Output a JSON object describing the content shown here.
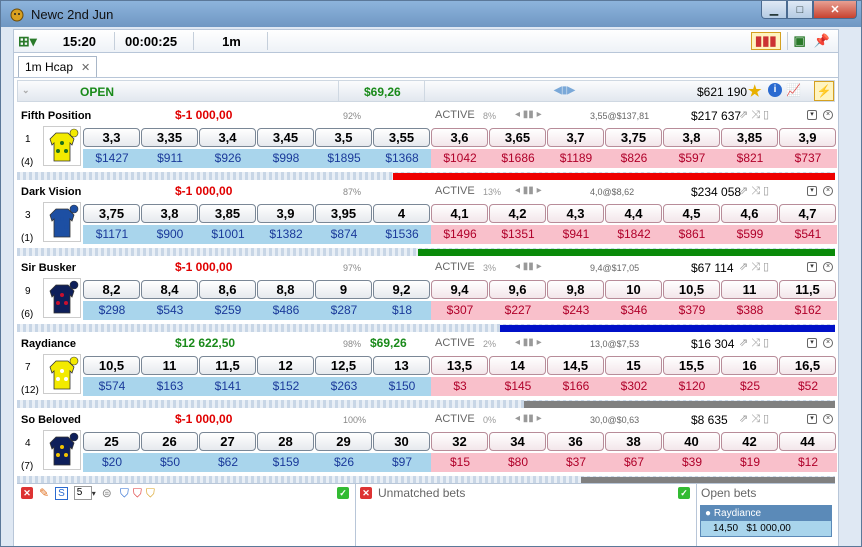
{
  "window": {
    "title": "Newc 2nd Jun"
  },
  "toolbar": {
    "time": "15:20",
    "countdown": "00:00:25",
    "distance": "1m"
  },
  "tab": {
    "label": "1m Hcap"
  },
  "market": {
    "status": "OPEN",
    "pl": "$69,26",
    "total": "$621 190"
  },
  "runners": [
    {
      "name": "Fifth Position",
      "pl": "$-1 000,00",
      "pl_type": "neg",
      "pct": "92%",
      "pl_right": "",
      "status": "ACTIVE",
      "active_pct": "8%",
      "avg": "3,55@$137,81",
      "matched": "$217 637",
      "number": "1",
      "draw": "(4)",
      "silk_colors": [
        "#f3ea00",
        "#1c6e1c"
      ],
      "back_odds": [
        "3,3",
        "3,35",
        "3,4",
        "3,45",
        "3,5",
        "3,55"
      ],
      "back_amts": [
        "$1427",
        "$911",
        "$926",
        "$998",
        "$1895",
        "$1368"
      ],
      "lay_odds": [
        "3,6",
        "3,65",
        "3,7",
        "3,75",
        "3,8",
        "3,85",
        "3,9"
      ],
      "lay_amts": [
        "$1042",
        "$1686",
        "$1189",
        "$826",
        "$597",
        "$821",
        "$737"
      ],
      "bar_color": "#ee0000",
      "bar_fraction": 0.54
    },
    {
      "name": "Dark Vision",
      "pl": "$-1 000,00",
      "pl_type": "neg",
      "pct": "87%",
      "pl_right": "",
      "status": "ACTIVE",
      "active_pct": "13%",
      "avg": "4,0@$8,62",
      "matched": "$234 058",
      "number": "3",
      "draw": "(1)",
      "silk_colors": [
        "#1d4fa3",
        "#1d4fa3"
      ],
      "back_odds": [
        "3,75",
        "3,8",
        "3,85",
        "3,9",
        "3,95",
        "4"
      ],
      "back_amts": [
        "$1171",
        "$900",
        "$1001",
        "$1382",
        "$874",
        "$1536"
      ],
      "lay_odds": [
        "4,1",
        "4,2",
        "4,3",
        "4,4",
        "4,5",
        "4,6",
        "4,7"
      ],
      "lay_amts": [
        "$1496",
        "$1351",
        "$941",
        "$1842",
        "$861",
        "$599",
        "$541"
      ],
      "bar_color": "#0a8a0a",
      "bar_fraction": 0.51
    },
    {
      "name": "Sir Busker",
      "pl": "$-1 000,00",
      "pl_type": "neg",
      "pct": "97%",
      "pl_right": "",
      "status": "ACTIVE",
      "active_pct": "3%",
      "avg": "9,4@$17,05",
      "matched": "$67 114",
      "number": "9",
      "draw": "(6)",
      "silk_colors": [
        "#0e1f5a",
        "#c8102e"
      ],
      "back_odds": [
        "8,2",
        "8,4",
        "8,6",
        "8,8",
        "9",
        "9,2"
      ],
      "back_amts": [
        "$298",
        "$543",
        "$259",
        "$486",
        "$287",
        "$18"
      ],
      "lay_odds": [
        "9,4",
        "9,6",
        "9,8",
        "10",
        "10,5",
        "11",
        "11,5"
      ],
      "lay_amts": [
        "$307",
        "$227",
        "$243",
        "$346",
        "$379",
        "$388",
        "$162"
      ],
      "bar_color": "#0010c8",
      "bar_fraction": 0.41
    },
    {
      "name": "Raydiance",
      "pl": "$12 622,50",
      "pl_type": "pos",
      "pct": "98%",
      "pl_right": "$69,26",
      "status": "ACTIVE",
      "active_pct": "2%",
      "avg": "13,0@$7,53",
      "matched": "$16 304",
      "number": "7",
      "draw": "(12)",
      "silk_colors": [
        "#f3ea00",
        "#ffffff"
      ],
      "back_odds": [
        "10,5",
        "11",
        "11,5",
        "12",
        "12,5",
        "13"
      ],
      "back_amts": [
        "$574",
        "$163",
        "$141",
        "$152",
        "$263",
        "$150"
      ],
      "lay_odds": [
        "13,5",
        "14",
        "14,5",
        "15",
        "15,5",
        "16",
        "16,5"
      ],
      "lay_amts": [
        "$3",
        "$145",
        "$166",
        "$302",
        "$120",
        "$25",
        "$52"
      ],
      "bar_color": "#808080",
      "bar_fraction": 0.38
    },
    {
      "name": "So Beloved",
      "pl": "$-1 000,00",
      "pl_type": "neg",
      "pct": "100%",
      "pl_right": "",
      "status": "ACTIVE",
      "active_pct": "0%",
      "avg": "30,0@$0,63",
      "matched": "$8 635",
      "number": "4",
      "draw": "(7)",
      "silk_colors": [
        "#0e1f5a",
        "#f3c400"
      ],
      "back_odds": [
        "25",
        "26",
        "27",
        "28",
        "29",
        "30"
      ],
      "back_amts": [
        "$20",
        "$50",
        "$62",
        "$159",
        "$26",
        "$97"
      ],
      "lay_odds": [
        "32",
        "34",
        "36",
        "38",
        "40",
        "42",
        "44"
      ],
      "lay_amts": [
        "$15",
        "$80",
        "$37",
        "$67",
        "$39",
        "$19",
        "$12"
      ],
      "bar_color": "#808080",
      "bar_fraction": 0.31
    }
  ],
  "bottom": {
    "stake_value": "5",
    "unmatched_label": "Unmatched bets",
    "open_label": "Open bets",
    "open_bet": {
      "runner": "Raydiance",
      "odds": "14,50",
      "stake": "$1 000,00"
    }
  }
}
